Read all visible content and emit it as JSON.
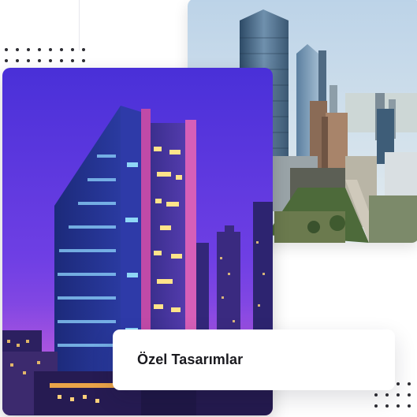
{
  "card": {
    "title": "Özel Tasarımlar"
  },
  "images": {
    "back": "city-skyline-daytime-photo",
    "front": "office-tower-night-photo"
  },
  "colors": {
    "night_sky_top": "#4a2fd6",
    "night_sky_bottom": "#a24fe0",
    "day_sky": "#cfe0ef",
    "dots": "#2d2d33",
    "card_text": "#1a1a1f"
  }
}
